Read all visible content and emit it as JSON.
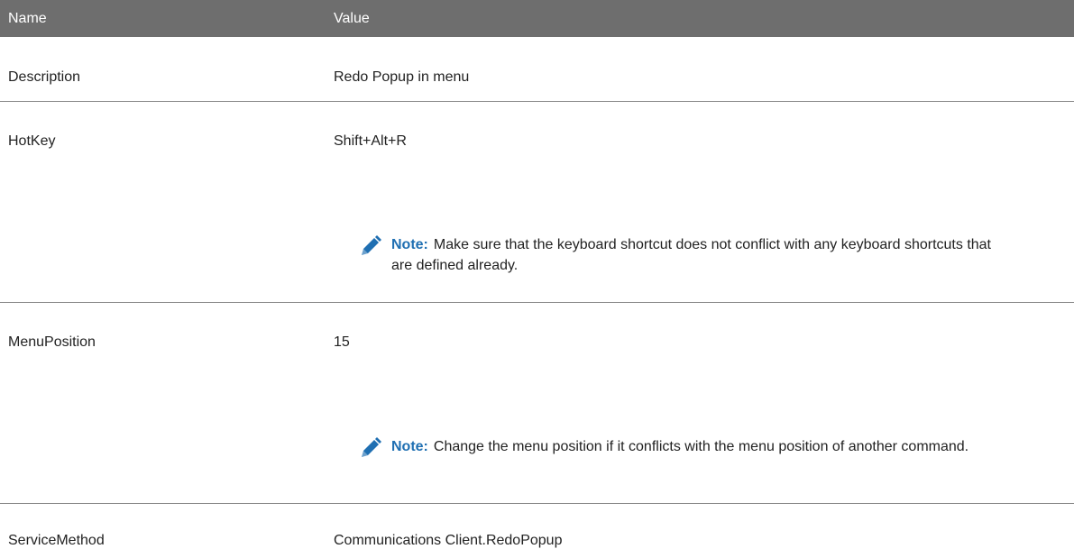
{
  "header": {
    "name": "Name",
    "value": "Value"
  },
  "rows": [
    {
      "name": "Description",
      "value": "Redo Popup in menu"
    },
    {
      "name": "HotKey",
      "value": "Shift+Alt+R",
      "note": {
        "label": "Note:",
        "text": "Make sure that the keyboard shortcut does not conflict with any keyboard shortcuts that are defined already."
      }
    },
    {
      "name": "MenuPosition",
      "value": "15",
      "note": {
        "label": "Note:",
        "text": "Change the menu position if it conflicts with the menu position of another command."
      }
    },
    {
      "name": "ServiceMethod",
      "value": "Communications Client.RedoPopup"
    }
  ],
  "colors": {
    "header_bg": "#6e6e6e",
    "note_label": "#1f6fb2",
    "pencil": "#1f6fb2"
  },
  "icons": {
    "note": "pencil-icon"
  }
}
